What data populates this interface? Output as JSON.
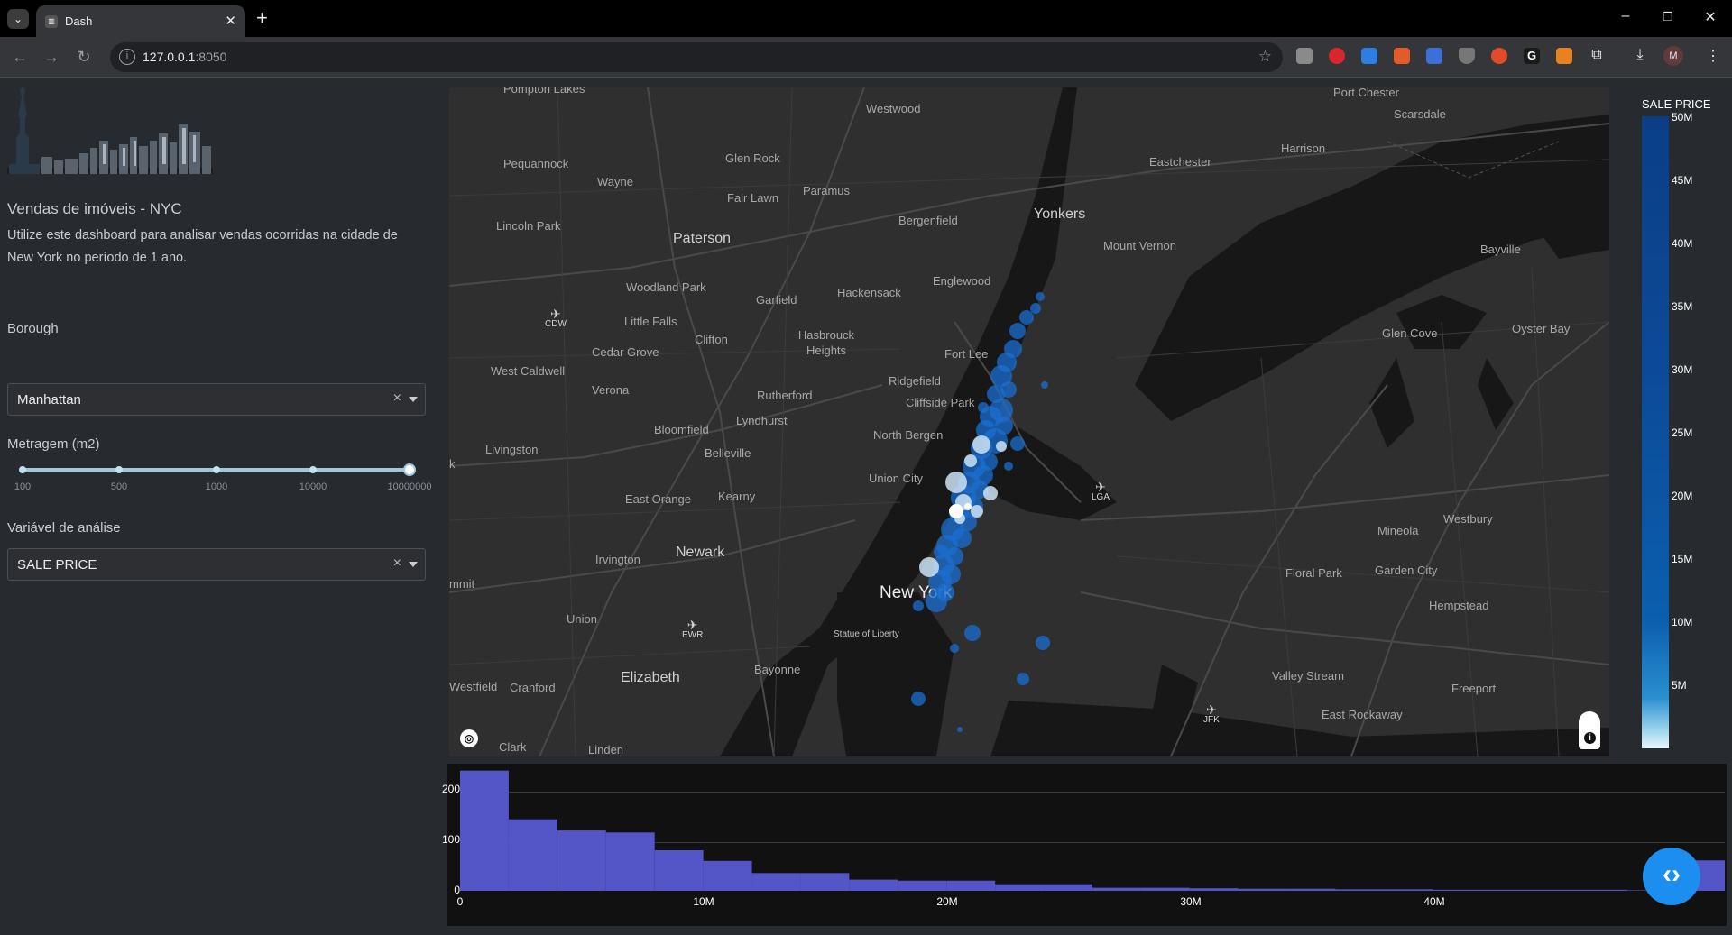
{
  "browser": {
    "tab_title": "Dash",
    "favicon": "dash-favicon",
    "url_host": "127.0.0.1",
    "url_port": ":8050",
    "avatar_letter": "M"
  },
  "app": {
    "title": "Vendas de imóveis - NYC",
    "description": "Utilize este dashboard para analisar vendas ocorridas na cidade de New York no período de 1 ano.",
    "borough_label": "Borough",
    "borough_value": "Manhattan",
    "metragem_label": "Metragem (m2)",
    "slider_marks": [
      "100",
      "500",
      "1000",
      "10000",
      "10000000"
    ],
    "variable_label": "Variável de análise",
    "variable_value": "SALE PRICE"
  },
  "map": {
    "places": [
      "Pompton Lakes",
      "Westwood",
      "Port Chester",
      "Scarsdale",
      "Harrison",
      "Pequannock",
      "Glen Rock",
      "Wayne",
      "Paramus",
      "Fair Lawn",
      "Eastchester",
      "Lincoln Park",
      "Paterson",
      "Bergenfield",
      "Yonkers",
      "Mount Vernon",
      "Bayville",
      "Woodland Park",
      "Garfield",
      "Hackensack",
      "Englewood",
      "Little Falls",
      "Clifton",
      "Hasbrouck Heights",
      "Cedar Grove",
      "Fort Lee",
      "Glen Cove",
      "Oyster Bay",
      "West Caldwell",
      "Ridgefield",
      "Verona",
      "Rutherford",
      "Cliffside Park",
      "Bloomfield",
      "Lyndhurst",
      "North Bergen",
      "Livingston",
      "Belleville",
      "Union City",
      "East Orange",
      "Kearny",
      "Westbury",
      "Mineola",
      "Newark",
      "Irvington",
      "Floral Park",
      "Garden City",
      "New York",
      "Hempstead",
      "Statue of Liberty",
      "Union",
      "Elizabeth",
      "Bayonne",
      "Valley Stream",
      "Freeport",
      "Westfield",
      "Cranford",
      "East Rockaway",
      "Clark",
      "Linden",
      "mmit",
      "k"
    ],
    "airports": [
      "CDW",
      "LGA",
      "EWR",
      "JFK"
    ]
  },
  "colorbar": {
    "title": "SALE PRICE",
    "ticks": [
      "50M",
      "45M",
      "40M",
      "35M",
      "30M",
      "25M",
      "20M",
      "15M",
      "10M",
      "5M"
    ],
    "colors": [
      "#0b3e86",
      "#0b5fae",
      "#9ad4ec",
      "#e6f5fb"
    ]
  },
  "chart_data": {
    "type": "bar",
    "title": "",
    "xlabel": "",
    "ylabel": "",
    "bar_color": "#5455c7",
    "x_ticks": [
      "0",
      "10M",
      "20M",
      "30M",
      "40M"
    ],
    "y_ticks": [
      "0",
      "100",
      "200"
    ],
    "xlim": [
      0,
      52000000
    ],
    "ylim": [
      0,
      240
    ],
    "bin_width": 2000000,
    "values": [
      237,
      141,
      119,
      115,
      80,
      59,
      35,
      35,
      22,
      20,
      20,
      13,
      13,
      6,
      6,
      5,
      4,
      4,
      3,
      3,
      2,
      2,
      2,
      2,
      1,
      60
    ]
  }
}
